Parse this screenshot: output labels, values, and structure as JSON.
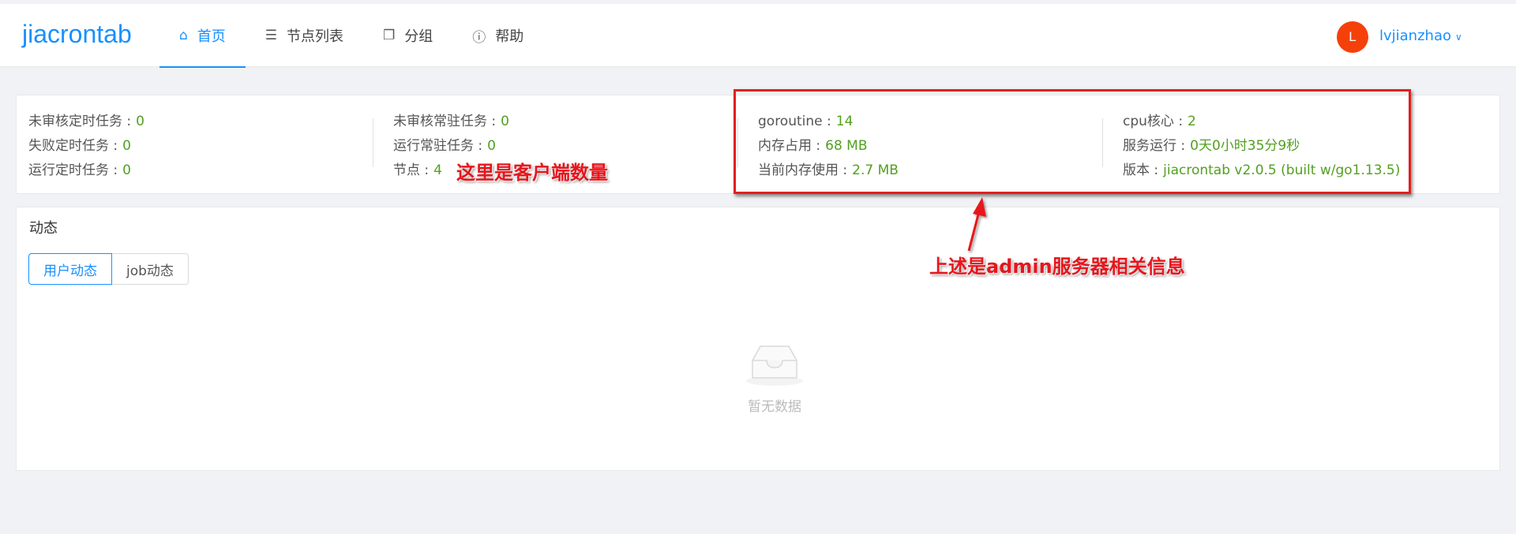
{
  "app": {
    "logo": "jiacrontab"
  },
  "nav": {
    "items": [
      {
        "label": "首页",
        "icon": "home-icon",
        "active": true
      },
      {
        "label": "节点列表",
        "icon": "list-icon",
        "active": false
      },
      {
        "label": "分组",
        "icon": "copy-icon",
        "active": false
      },
      {
        "label": "帮助",
        "icon": "info-icon",
        "active": false
      }
    ]
  },
  "user": {
    "avatar_letter": "L",
    "name": "lvjianzhao",
    "avatar_color": "#f5400a"
  },
  "stats": {
    "col1": [
      {
        "label": "未审核定时任务 :",
        "value": "0"
      },
      {
        "label": "失败定时任务 :",
        "value": "0"
      },
      {
        "label": "运行定时任务 :",
        "value": "0"
      }
    ],
    "col2": [
      {
        "label": "未审核常驻任务 :",
        "value": "0"
      },
      {
        "label": "运行常驻任务 :",
        "value": "0"
      },
      {
        "label": "节点 :",
        "value": "4"
      }
    ],
    "col3": [
      {
        "label": "goroutine :",
        "value": "14"
      },
      {
        "label": "内存占用 :",
        "value": "68 MB"
      },
      {
        "label": "当前内存使用 :",
        "value": "2.7 MB"
      }
    ],
    "col4": [
      {
        "label": "cpu核心 :",
        "value": "2"
      },
      {
        "label": "服务运行 :",
        "value": "0天0小时35分9秒"
      },
      {
        "label": "版本 :",
        "value": "jiacrontab v2.0.5 (built w/go1.13.5)"
      }
    ]
  },
  "activity": {
    "title": "动态",
    "tabs": [
      "用户动态",
      "job动态"
    ],
    "empty_text": "暂无数据"
  },
  "annotations": {
    "clients_note": "这里是客户端数量",
    "admin_note": "上述是admin服务器相关信息",
    "color": "#e8151c"
  },
  "colors": {
    "accent": "#1890ff",
    "value_green": "#52a020"
  }
}
